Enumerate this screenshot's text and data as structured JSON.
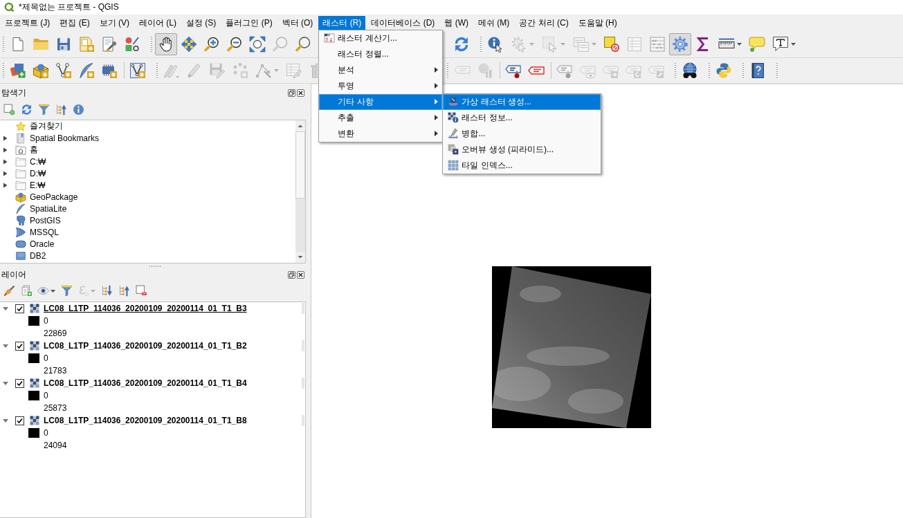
{
  "window": {
    "title": "*제목없는 프로젝트 - QGIS"
  },
  "menu_bar": {
    "items": [
      {
        "label": "프로젝트 (J)",
        "selected": false
      },
      {
        "label": "편집 (E)",
        "selected": false
      },
      {
        "label": "보기 (V)",
        "selected": false
      },
      {
        "label": "레이어 (L)",
        "selected": false
      },
      {
        "label": "설정 (S)",
        "selected": false
      },
      {
        "label": "플러그인 (P)",
        "selected": false
      },
      {
        "label": "벡터 (O)",
        "selected": false
      },
      {
        "label": "래스터 (R)",
        "selected": true
      },
      {
        "label": "데이터베이스 (D)",
        "selected": false
      },
      {
        "label": "웹 (W)",
        "selected": false
      },
      {
        "label": "메쉬 (M)",
        "selected": false
      },
      {
        "label": "공간 처리 (C)",
        "selected": false
      },
      {
        "label": "도움말 (H)",
        "selected": false
      }
    ]
  },
  "open_menu": {
    "items": [
      {
        "label": "래스터 계산기...",
        "has_submenu": false,
        "selected": false
      },
      {
        "label": "래스터 정렬...",
        "has_submenu": false,
        "selected": false
      },
      {
        "label": "분석",
        "has_submenu": true,
        "selected": false
      },
      {
        "label": "투영",
        "has_submenu": true,
        "selected": false
      },
      {
        "label": "기타 사항",
        "has_submenu": true,
        "selected": true,
        "submenu": {
          "items": [
            {
              "label": "가상 래스터 생성...",
              "selected": true
            },
            {
              "label": "래스터 정보...",
              "selected": false
            },
            {
              "label": "병합...",
              "selected": false
            },
            {
              "label": "오버뷰 생성 (피라미드)...",
              "selected": false
            },
            {
              "label": "타일 인덱스...",
              "selected": false
            }
          ]
        }
      },
      {
        "label": "추출",
        "has_submenu": true,
        "selected": false
      },
      {
        "label": "변환",
        "has_submenu": true,
        "selected": false
      }
    ]
  },
  "toolbars": [
    {
      "buttons": [
        {
          "selected": false,
          "disabled": false
        },
        {
          "selected": false,
          "disabled": false
        },
        {
          "selected": false,
          "disabled": false
        },
        {
          "selected": false,
          "disabled": false
        },
        {
          "selected": false,
          "disabled": false
        },
        {
          "selected": false,
          "disabled": false
        },
        {
          "selected": true,
          "disabled": false
        },
        {
          "selected": false,
          "disabled": false
        },
        {
          "selected": false,
          "disabled": false
        },
        {
          "selected": false,
          "disabled": false
        },
        {
          "selected": false,
          "disabled": false
        },
        {
          "selected": false,
          "disabled": true
        },
        {
          "selected": false,
          "disabled": false
        },
        {
          "selected": false,
          "disabled": false
        },
        {
          "selected": false,
          "disabled": false
        },
        {
          "selected": false,
          "disabled": true
        },
        {
          "selected": false,
          "disabled": true
        },
        {
          "selected": false,
          "disabled": true
        },
        {
          "selected": false,
          "disabled": false
        },
        {
          "selected": false,
          "disabled": true
        },
        {
          "selected": false,
          "disabled": true
        },
        {
          "selected": true,
          "disabled": false
        },
        {
          "selected": false,
          "disabled": false
        },
        {
          "selected": false,
          "disabled": false
        },
        {
          "selected": false,
          "disabled": false
        },
        {
          "selected": false,
          "disabled": false
        }
      ]
    },
    {
      "buttons": [
        {
          "selected": false,
          "disabled": false
        },
        {
          "selected": false,
          "disabled": false
        },
        {
          "selected": false,
          "disabled": false
        },
        {
          "selected": false,
          "disabled": false
        },
        {
          "selected": false,
          "disabled": false
        },
        {
          "selected": false,
          "disabled": false
        },
        {
          "selected": false,
          "disabled": true
        },
        {
          "selected": false,
          "disabled": true
        },
        {
          "selected": false,
          "disabled": true
        },
        {
          "selected": false,
          "disabled": true
        },
        {
          "selected": false,
          "disabled": true
        },
        {
          "selected": false,
          "disabled": true
        },
        {
          "selected": false,
          "disabled": true
        },
        {
          "selected": false,
          "disabled": true
        },
        {
          "selected": false,
          "disabled": true
        },
        {
          "selected": false,
          "disabled": false
        },
        {
          "selected": false,
          "disabled": false
        },
        {
          "selected": false,
          "disabled": true
        },
        {
          "selected": false,
          "disabled": true
        },
        {
          "selected": false,
          "disabled": true
        },
        {
          "selected": false,
          "disabled": true
        },
        {
          "selected": false,
          "disabled": true
        },
        {
          "selected": false,
          "disabled": false
        },
        {
          "selected": false,
          "disabled": false
        },
        {
          "selected": false,
          "disabled": false
        }
      ]
    }
  ],
  "browser_panel": {
    "title": "탐색기",
    "toolbar": [
      {
        "disabled": false
      },
      {
        "disabled": false
      },
      {
        "disabled": false
      },
      {
        "disabled": false
      },
      {
        "disabled": false
      }
    ],
    "items": [
      {
        "label": "즐겨찾기"
      },
      {
        "label": "Spatial Bookmarks",
        "expanded": false
      },
      {
        "label": "홈",
        "expanded": false
      },
      {
        "label": "C:₩",
        "expanded": false
      },
      {
        "label": "D:₩",
        "expanded": false
      },
      {
        "label": "E:₩",
        "expanded": false
      },
      {
        "label": "GeoPackage"
      },
      {
        "label": "SpatiaLite"
      },
      {
        "label": "PostGIS"
      },
      {
        "label": "MSSQL"
      },
      {
        "label": "Oracle"
      },
      {
        "label": "DB2"
      }
    ]
  },
  "layers_panel": {
    "title": "레이어",
    "toolbar": [
      {
        "disabled": false
      },
      {
        "disabled": false
      },
      {
        "disabled": false
      },
      {
        "disabled": false
      },
      {
        "disabled": true
      },
      {
        "disabled": false
      },
      {
        "disabled": false
      },
      {
        "disabled": false
      }
    ],
    "layers": [
      {
        "name": "LC08_L1TP_114036_20200109_20200114_01_T1_B3",
        "expanded": true,
        "checked": true,
        "underlined": true,
        "legend": [
          "0",
          "22869"
        ]
      },
      {
        "name": "LC08_L1TP_114036_20200109_20200114_01_T1_B2",
        "expanded": true,
        "checked": true,
        "underlined": false,
        "legend": [
          "0",
          "21783"
        ]
      },
      {
        "name": "LC08_L1TP_114036_20200109_20200114_01_T1_B4",
        "expanded": true,
        "checked": true,
        "underlined": false,
        "legend": [
          "0",
          "25873"
        ]
      },
      {
        "name": "LC08_L1TP_114036_20200109_20200114_01_T1_B8",
        "expanded": true,
        "checked": true,
        "underlined": false,
        "legend": [
          "0",
          "24094"
        ]
      }
    ]
  }
}
